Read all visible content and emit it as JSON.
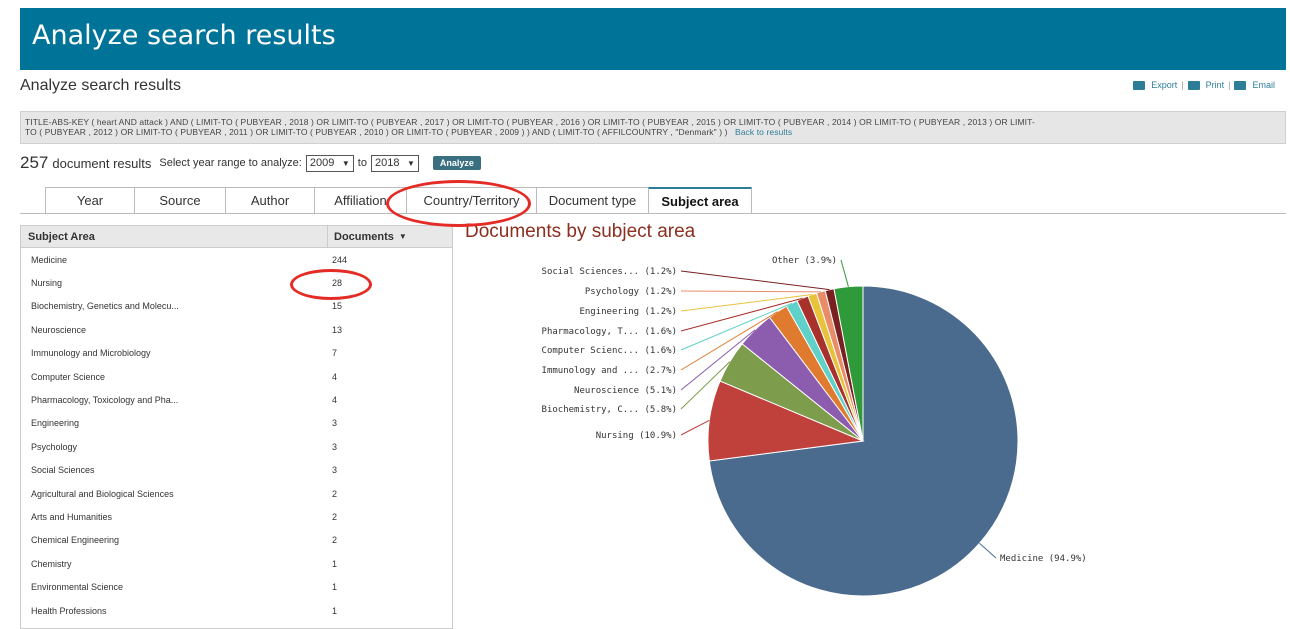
{
  "banner": {
    "title": "Analyze search results"
  },
  "page": {
    "subtitle": "Analyze search results"
  },
  "toolbar": {
    "export": "Export",
    "print": "Print",
    "email": "Email"
  },
  "query": {
    "line1_a": "TITLE-ABS-KEY ( ",
    "line1_b": "heart",
    "line1_c": " AND ",
    "line1_d": "attack",
    "line1_e": " ) AND ( LIMIT-TO ( PUBYEAR , ",
    "full_line1": "TITLE-ABS-KEY ( heart AND attack ) AND ( LIMIT-TO ( PUBYEAR , 2018 ) OR LIMIT-TO ( PUBYEAR , 2017 ) OR LIMIT-TO ( PUBYEAR , 2016 ) OR LIMIT-TO ( PUBYEAR , 2015 ) OR LIMIT-TO ( PUBYEAR , 2014 ) OR LIMIT-TO ( PUBYEAR , 2013 ) OR LIMIT-",
    "full_line2": "TO ( PUBYEAR , 2012 ) OR LIMIT-TO ( PUBYEAR , 2011 ) OR LIMIT-TO ( PUBYEAR , 2010 ) OR LIMIT-TO ( PUBYEAR , 2009 ) ) AND ( LIMIT-TO ( AFFILCOUNTRY , \"Denmark\" ) )",
    "back_link": "Back to results"
  },
  "results": {
    "count": "257",
    "label": "document results",
    "year_range_label": "Select year range to analyze:",
    "from_year": "2009",
    "to_label": "to",
    "to_year": "2018",
    "analyze_button": "Analyze"
  },
  "tabs": [
    {
      "label": "Year",
      "active": false
    },
    {
      "label": "Source",
      "active": false
    },
    {
      "label": "Author",
      "active": false
    },
    {
      "label": "Affiliation",
      "active": false
    },
    {
      "label": "Country/Territory",
      "active": false
    },
    {
      "label": "Document type",
      "active": false
    },
    {
      "label": "Subject area",
      "active": true
    }
  ],
  "table": {
    "col_subject": "Subject Area",
    "col_documents": "Documents",
    "rows": [
      {
        "name": "Medicine",
        "count": "244"
      },
      {
        "name": "Nursing",
        "count": "28"
      },
      {
        "name": "Biochemistry, Genetics and Molecu...",
        "count": "15"
      },
      {
        "name": "Neuroscience",
        "count": "13"
      },
      {
        "name": "Immunology and Microbiology",
        "count": "7"
      },
      {
        "name": "Computer Science",
        "count": "4"
      },
      {
        "name": "Pharmacology, Toxicology and Pha...",
        "count": "4"
      },
      {
        "name": "Engineering",
        "count": "3"
      },
      {
        "name": "Psychology",
        "count": "3"
      },
      {
        "name": "Social Sciences",
        "count": "3"
      },
      {
        "name": "Agricultural and Biological Sciences",
        "count": "2"
      },
      {
        "name": "Arts and Humanities",
        "count": "2"
      },
      {
        "name": "Chemical Engineering",
        "count": "2"
      },
      {
        "name": "Chemistry",
        "count": "1"
      },
      {
        "name": "Environmental Science",
        "count": "1"
      },
      {
        "name": "Health Professions",
        "count": "1"
      }
    ]
  },
  "chart_data": {
    "type": "pie",
    "title": "Documents by subject area",
    "slices": [
      {
        "label": "Medicine (94.9%)",
        "value": 94.9,
        "color": "#4a6b8e"
      },
      {
        "label": "Nursing (10.9%)",
        "value": 10.9,
        "color": "#c0403b"
      },
      {
        "label": "Biochemistry, C... (5.8%)",
        "value": 5.8,
        "color": "#7d9c4c"
      },
      {
        "label": "Neuroscience (5.1%)",
        "value": 5.1,
        "color": "#8c5caf"
      },
      {
        "label": "Immunology and ... (2.7%)",
        "value": 2.7,
        "color": "#e07a2e"
      },
      {
        "label": "Computer Scienc... (1.6%)",
        "value": 1.6,
        "color": "#5fd1c8"
      },
      {
        "label": "Pharmacology, T... (1.6%)",
        "value": 1.6,
        "color": "#a8312c"
      },
      {
        "label": "Engineering (1.2%)",
        "value": 1.2,
        "color": "#e8c23a"
      },
      {
        "label": "Psychology (1.2%)",
        "value": 1.2,
        "color": "#e88c6a"
      },
      {
        "label": "Social Sciences... (1.2%)",
        "value": 1.2,
        "color": "#7a2020"
      },
      {
        "label": "Other (3.9%)",
        "value": 3.9,
        "color": "#2f9a3a"
      }
    ]
  }
}
